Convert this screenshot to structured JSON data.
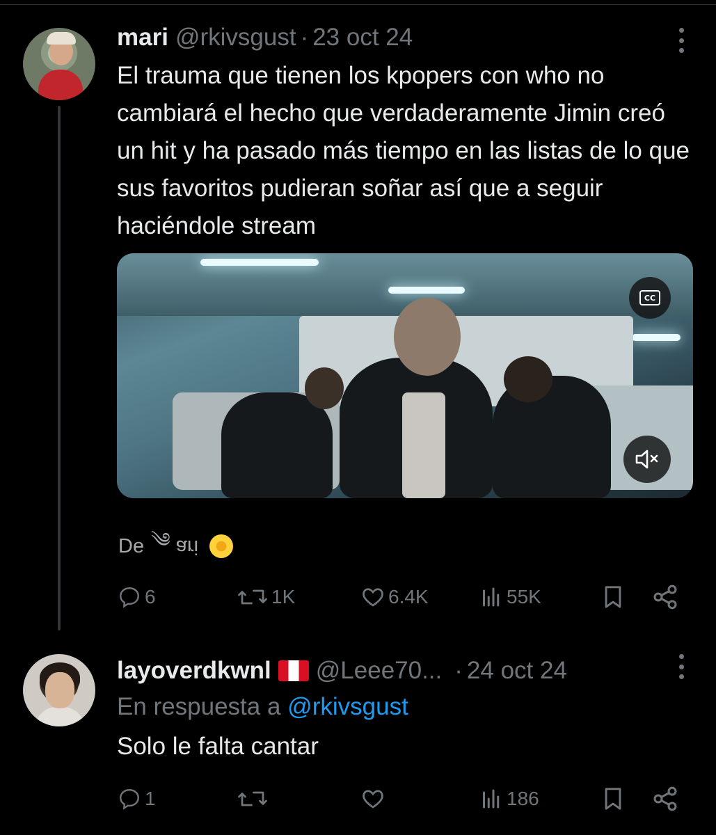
{
  "tweets": [
    {
      "author": {
        "display_name": "mari",
        "handle": "@rkivsgust",
        "avatar_icon": "avatar-photo"
      },
      "separator": "·",
      "date": "23 oct 24",
      "text": "El trauma que tienen los kpopers con who no cambiará el hecho que verdaderamente Jimin creó un hit y ha pasado más tiempo en las listas de lo que sus favoritos pudieran soñar así que a seguir haciéndole stream",
      "media": {
        "type": "video",
        "cc_label": "CC",
        "cc_icon": "closed-captions-icon",
        "mute_icon": "volume-muted-icon"
      },
      "source": {
        "prefix": "De",
        "name_flipped": "ari",
        "swirl": "༄",
        "emoji_icon": "sunflower-emoji"
      },
      "actions": {
        "replies": "6",
        "reposts": "1K",
        "likes": "6.4K",
        "views": "55K"
      }
    },
    {
      "author": {
        "display_name": "layoverdkwnl",
        "handle": "@Leee70...",
        "flag_icon": "peru-flag",
        "avatar_icon": "avatar-photo"
      },
      "separator": "·",
      "date": "24 oct 24",
      "reply_to": {
        "prefix": "En respuesta a",
        "mention": "@rkivsgust"
      },
      "text": "Solo le falta cantar",
      "actions": {
        "replies": "1",
        "reposts": "",
        "likes": "",
        "views": "186"
      }
    }
  ],
  "colors": {
    "background": "#000000",
    "text": "#e7e9ea",
    "secondary": "#71767b",
    "accent": "#1d9bf0",
    "divider": "#2f3336"
  }
}
